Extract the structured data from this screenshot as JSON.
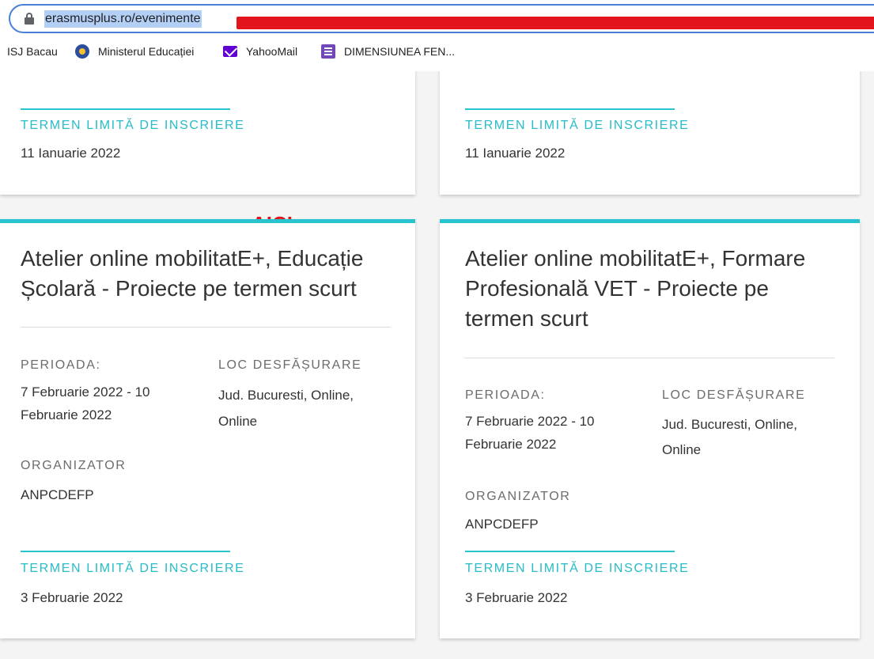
{
  "browser": {
    "url": "erasmusplus.ro/evenimente",
    "bookmarks": [
      {
        "label": "ISJ Bacau",
        "icon": "none"
      },
      {
        "label": "Ministerul Educației",
        "icon": "government-crest-icon"
      },
      {
        "label": "YahooMail",
        "icon": "mail-icon"
      },
      {
        "label": "DIMENSIUNEA FEN...",
        "icon": "form-icon"
      }
    ]
  },
  "annotation": {
    "text": "AICI",
    "color": "#e2141c"
  },
  "colors": {
    "accent": "#27c3cf",
    "redaction": "#e2141c"
  },
  "cards_top": [
    {
      "deadline_label": "TERMEN LIMITĂ DE INSCRIERE",
      "deadline": "11 Ianuarie 2022"
    },
    {
      "deadline_label": "TERMEN LIMITĂ DE INSCRIERE",
      "deadline": "11 Ianuarie 2022"
    }
  ],
  "cards": [
    {
      "title": [
        "Atelier online mobilitatE+, Educație",
        "Școlară - Proiecte pe termen scurt"
      ],
      "period_label": "PERIOADA:",
      "period": [
        "7 Februarie 2022 - 10",
        "Februarie 2022"
      ],
      "location_label": "LOC DESFĂȘURARE",
      "location": [
        "Jud. Bucuresti, Online,",
        "Online"
      ],
      "organizer_label": "ORGANIZATOR",
      "organizer": "ANPCDEFP",
      "deadline_label": "TERMEN LIMITĂ DE INSCRIERE",
      "deadline": "3 Februarie 2022"
    },
    {
      "title": [
        "Atelier online mobilitatE+, Formare",
        "Profesională VET - Proiecte pe",
        "termen scurt"
      ],
      "period_label": "PERIOADA:",
      "period": [
        "7 Februarie 2022 - 10",
        "Februarie 2022"
      ],
      "location_label": "LOC DESFĂȘURARE",
      "location": [
        "Jud. Bucuresti, Online,",
        "Online"
      ],
      "organizer_label": "ORGANIZATOR",
      "organizer": "ANPCDEFP",
      "deadline_label": "TERMEN LIMITĂ DE INSCRIERE",
      "deadline": "3 Februarie 2022"
    }
  ]
}
